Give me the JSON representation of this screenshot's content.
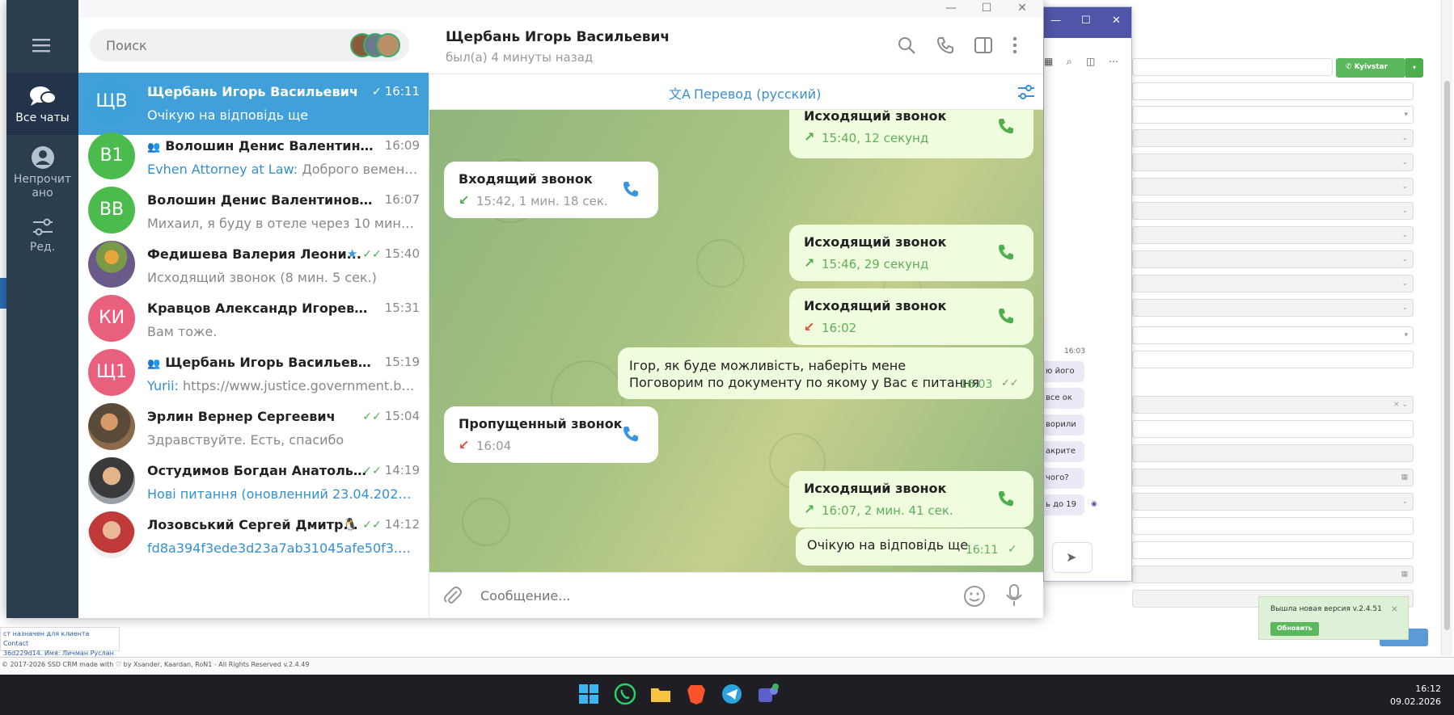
{
  "crm": {
    "phone_button_label": "Kyivstar",
    "footer_text": "© 2017-2026 SSD CRM made with ♡ by Xsander, Kaardan, RoN1 - All Rights Reserved v.2.4.49",
    "tooltip_line1": "ст назначен для клиента Contact",
    "tooltip_line2": "36d229d14. Имя: Личман Руслан",
    "notify_message": "Вышла новая версия v.2.4.51",
    "notify_button": "Обновить",
    "notify_close": "×"
  },
  "side_chat": {
    "time": "16:03",
    "fragments": [
      "ю його",
      "все ок",
      "ворили",
      "акрите",
      "чого?",
      "ь до 19"
    ]
  },
  "taskbar": {
    "time": "16:12",
    "date": "09.02.2026"
  },
  "window_controls": {
    "minimize": "—",
    "maximize": "☐",
    "close": "✕"
  },
  "nav": {
    "all_chats": "Все чаты",
    "unread_line1": "Непрочит",
    "unread_line2": "ано",
    "edit": "Ред."
  },
  "search": {
    "placeholder": "Поиск"
  },
  "chats": [
    {
      "initials": "ЩВ",
      "name": "Щербань Игорь Васильевич",
      "time": "16:11",
      "preview": "Очікую на відповідь ще",
      "sender": "",
      "color": "#3ea0d8"
    },
    {
      "initials": "В1",
      "name": "Волошин Денис Валентинови...",
      "time": "16:09",
      "preview": "Доброго вемени ...",
      "sender": "Evhen Attorney at Law: ",
      "color": "#4cbb4e"
    },
    {
      "initials": "ВВ",
      "name": "Волошин Денис Валентинович",
      "time": "16:07",
      "preview": "Михаил, я буду в отеле через 10 минут. ...",
      "sender": "",
      "color": "#4cbb4e"
    },
    {
      "initials": "",
      "name": "Федишева Валерия Леони...",
      "time": "15:40",
      "preview": "Исходящий звонок (8 мин. 5 сек.)",
      "sender": "",
      "color": "#9a7a5a"
    },
    {
      "initials": "КИ",
      "name": "Кравцов Александр Игоревич",
      "time": "15:31",
      "preview": "Вам тоже.",
      "sender": "",
      "color": "#e8607e"
    },
    {
      "initials": "Щ1",
      "name": "Щербань Игорь Васильевич 1...",
      "time": "15:19",
      "preview": "https://www.justice.government.bg/...",
      "sender": "Yurii: ",
      "color": "#e8607e"
    },
    {
      "initials": "",
      "name": "Эрлин Вернер Сергеевич",
      "time": "15:04",
      "preview": "Здравствуйте. Есть, спасибо",
      "sender": "",
      "color": "#b07a50"
    },
    {
      "initials": "",
      "name": "Остудимов Богдан Анатольев...",
      "time": "14:19",
      "preview": "Нові питання (оновленний 23.04.2025).d...",
      "sender": "",
      "color": "#6a5a4a"
    },
    {
      "initials": "",
      "name": "Лозовський Сергей Дмитр...",
      "time": "14:12",
      "preview": "fd8a394f3ede3d23a7ab31045afe50f3.pdf, ...",
      "sender": "",
      "color": "#c04040"
    }
  ],
  "header": {
    "title": "Щербань Игорь Васильевич",
    "status": "был(а) 4 минуты назад"
  },
  "translate": {
    "label": "Перевод (русский)"
  },
  "messages": {
    "m1": {
      "title": "Исходящий звонок",
      "sub": "15:40, 12 секунд"
    },
    "m2": {
      "title": "Входящий звонок",
      "sub": "15:42, 1 мин. 18 сек."
    },
    "m3": {
      "title": "Исходящий звонок",
      "sub": "15:46, 29 секунд"
    },
    "m4": {
      "title": "Исходящий звонок",
      "sub": "16:02"
    },
    "m5": {
      "text": "Ігор, як буде можливість, наберіть мене\nПоговорим по документу по якому у Вас є питання",
      "time": "16:03"
    },
    "m6": {
      "title": "Пропущенный звонок",
      "sub": "16:04"
    },
    "m7": {
      "title": "Исходящий звонок",
      "sub": "16:07, 2 мин. 41 сек."
    },
    "m8": {
      "text": "Очікую на відповідь ще",
      "time": "16:11"
    }
  },
  "composer": {
    "placeholder": "Сообщение..."
  },
  "colors": {
    "accent": "#419fd9",
    "nav_bg": "#2b3e50",
    "bubble_out": "#effdde",
    "missed": "#e2503a"
  }
}
